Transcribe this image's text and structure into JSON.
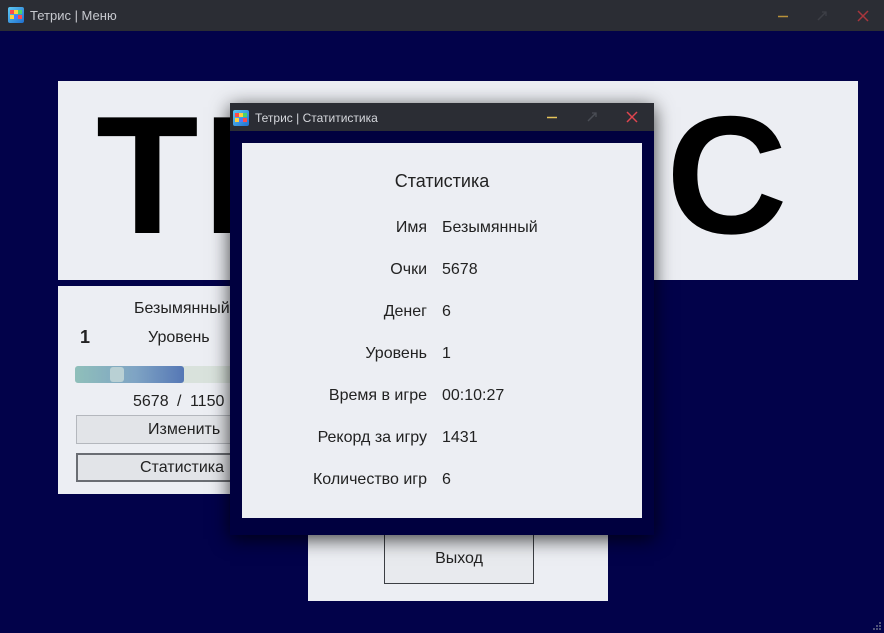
{
  "main_window": {
    "title": "Тетрис | Меню",
    "controls": {
      "minimize_icon": "minimize-icon",
      "maximize_icon": "maximize-icon",
      "close_icon": "close-icon"
    }
  },
  "logo": {
    "text": "ТЕТРИС"
  },
  "player_panel": {
    "name": "Безымянный",
    "level_number": "1",
    "level_label": "Уровень",
    "progress": {
      "current": "5678",
      "separator": "/",
      "total": "1150",
      "fill_fraction": 0.64
    },
    "edit_button": "Изменить",
    "stats_button": "Статистика"
  },
  "exit_button": "Выход",
  "stats_dialog": {
    "title": "Тетрис | Статитистика",
    "heading": "Статистика",
    "rows": [
      {
        "label": "Имя",
        "value": "Безымянный"
      },
      {
        "label": "Очки",
        "value": "5678"
      },
      {
        "label": "Денег",
        "value": "6"
      },
      {
        "label": "Уровень",
        "value": "1"
      },
      {
        "label": "Время в игре",
        "value": "00:10:27"
      },
      {
        "label": "Рекорд за игру",
        "value": "1431"
      },
      {
        "label": "Количество игр",
        "value": "6"
      }
    ]
  },
  "colors": {
    "background": "#02024a",
    "titlebar": "#2b2d34",
    "panel": "#eceef3",
    "minimize_accent": "#e6c55a",
    "close_accent": "#e0454f"
  }
}
